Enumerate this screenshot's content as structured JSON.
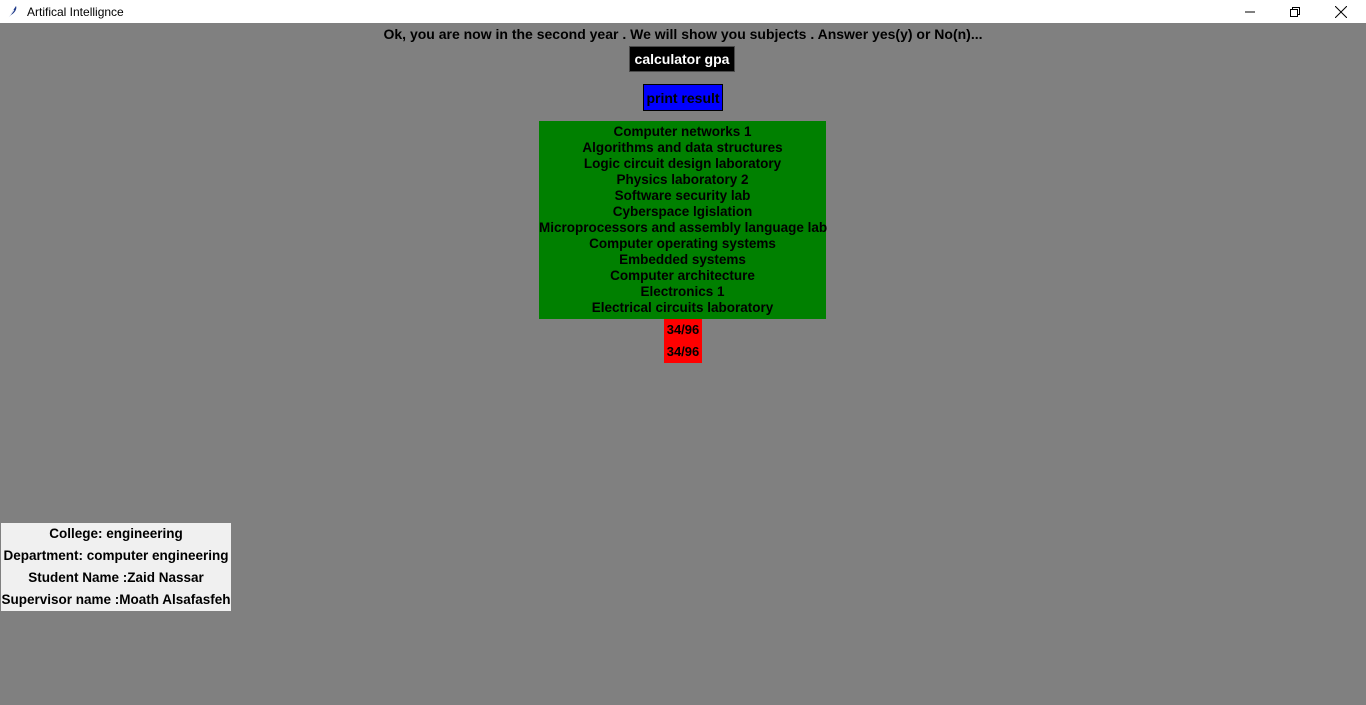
{
  "window": {
    "title": "Artifical Intellignce",
    "icons": {
      "app": "feather-icon",
      "minimize": "minimize-icon",
      "maximize": "restore-icon",
      "close": "close-icon"
    }
  },
  "main": {
    "prompt": "Ok, you are now in the second year . We will show you subjects . Answer yes(y) or No(n)...",
    "calculate_button": "calculator gpa",
    "print_button": "print result",
    "subjects": [
      "Computer networks 1",
      "Algorithms and data structures",
      "Logic circuit design laboratory",
      "Physics laboratory 2",
      "Software security lab",
      "Cyberspace lgislation",
      "Microprocessors and assembly language lab",
      "Computer operating systems",
      "Embedded systems",
      "Computer architecture",
      "Electronics 1",
      "Electrical circuits laboratory"
    ],
    "results": [
      "34/96",
      "34/96"
    ]
  },
  "info": {
    "college": "College: engineering",
    "department": "Department: computer engineering",
    "student": "Student Name :Zaid Nassar",
    "supervisor": "Supervisor name :Moath Alsafasfeh"
  },
  "colors": {
    "background": "#808080",
    "calculate_button": "#000000",
    "print_button": "#0000ff",
    "subjects_panel": "#008000",
    "results_panel": "#ff0000",
    "info_panel": "#f0f0f0"
  }
}
